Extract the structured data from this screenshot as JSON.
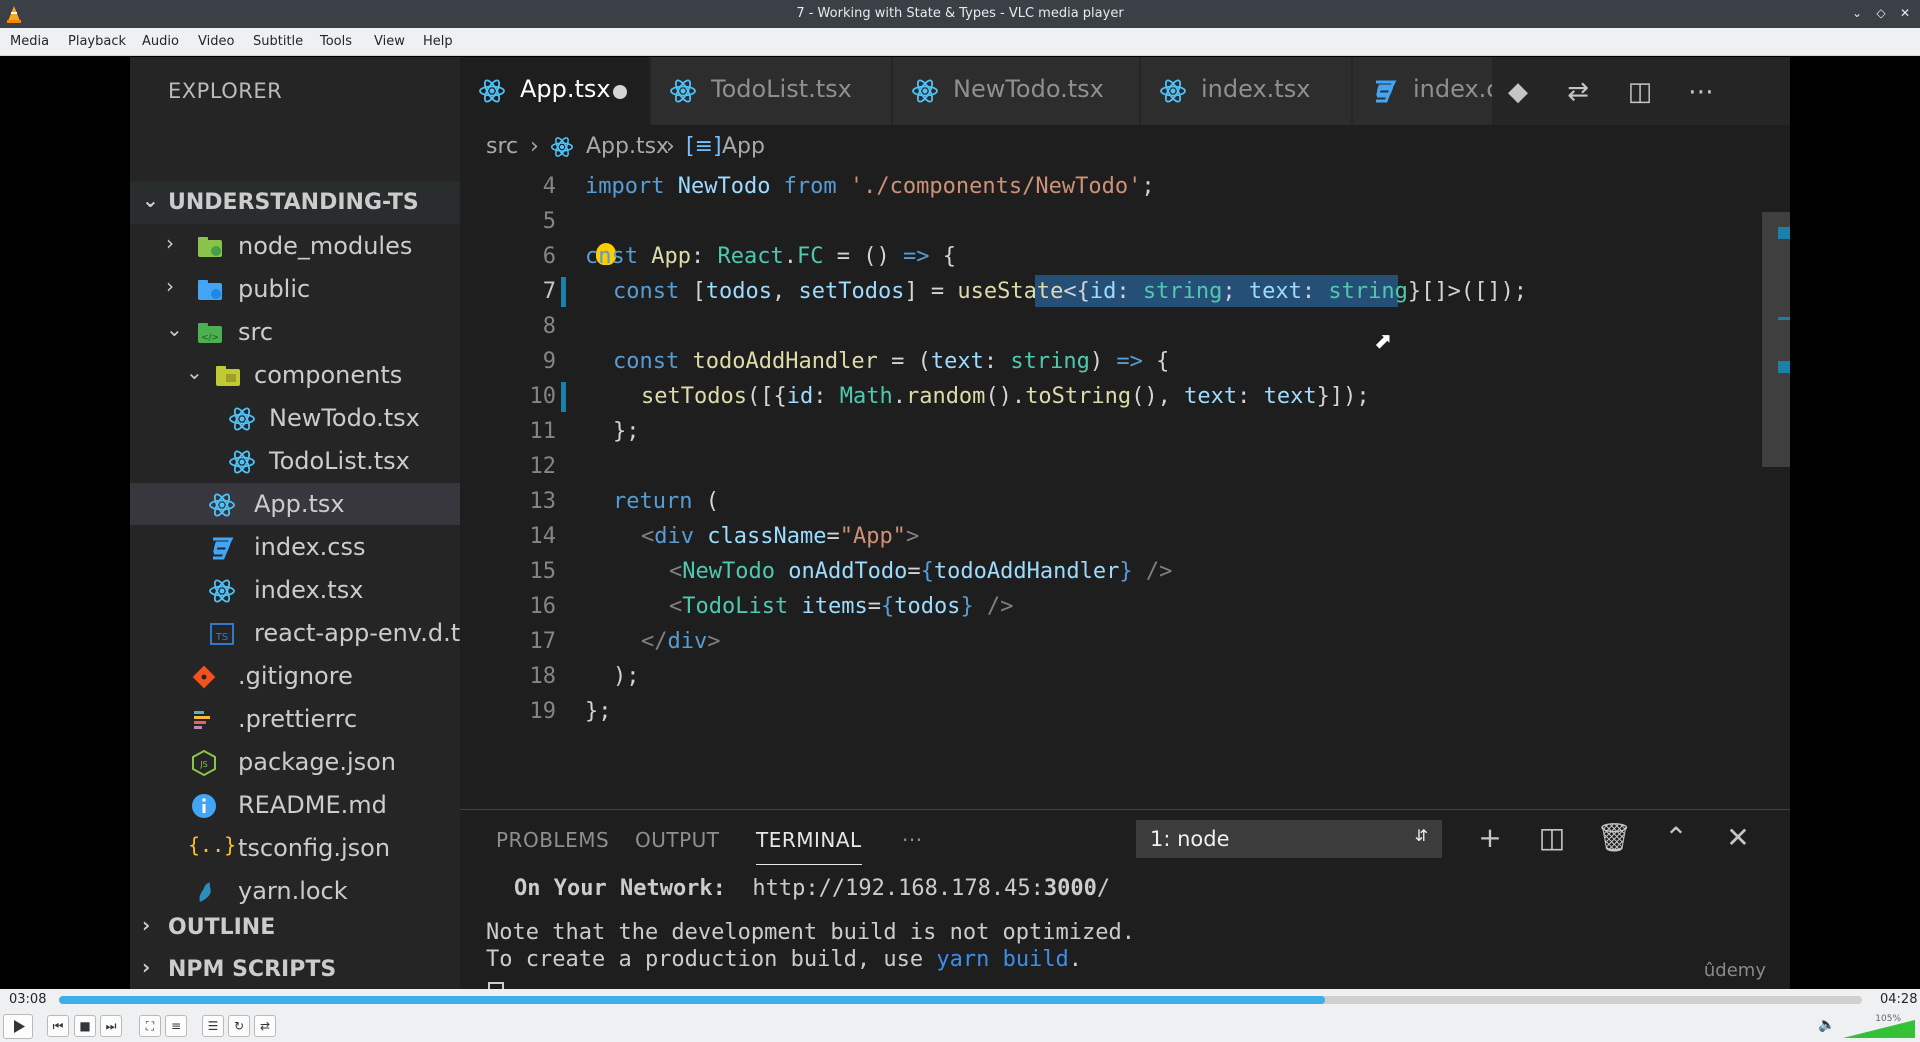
{
  "window": {
    "title": "7 - Working with State & Types - VLC media player"
  },
  "menu": [
    "Media",
    "Playback",
    "Audio",
    "Video",
    "Subtitle",
    "Tools",
    "View",
    "Help"
  ],
  "explorer": {
    "header": "EXPLORER",
    "project": "UNDERSTANDING-TS",
    "items": [
      {
        "label": "node_modules"
      },
      {
        "label": "public"
      },
      {
        "label": "src"
      },
      {
        "label": "components"
      },
      {
        "label": "NewTodo.tsx"
      },
      {
        "label": "TodoList.tsx"
      },
      {
        "label": "App.tsx"
      },
      {
        "label": "index.css"
      },
      {
        "label": "index.tsx"
      },
      {
        "label": "react-app-env.d.ts"
      },
      {
        "label": ".gitignore"
      },
      {
        "label": ".prettierrc"
      },
      {
        "label": "package.json"
      },
      {
        "label": "README.md"
      },
      {
        "label": "tsconfig.json"
      },
      {
        "label": "yarn.lock"
      }
    ],
    "outline": "OUTLINE",
    "npm_scripts": "NPM SCRIPTS"
  },
  "tabs": [
    "App.tsx",
    "TodoList.tsx",
    "NewTodo.tsx",
    "index.tsx",
    "index.cs"
  ],
  "breadcrumb": {
    "src": "src",
    "file": "App.tsx",
    "symbol": "App"
  },
  "code": {
    "line_numbers": [
      "4",
      "5",
      "6",
      "7",
      "8",
      "9",
      "10",
      "11",
      "12",
      "13",
      "14",
      "15",
      "16",
      "17",
      "18",
      "19"
    ],
    "l4": {
      "a": "import ",
      "b": "NewTodo",
      "c": " from ",
      "d": "'./components/NewTodo'",
      "e": ";"
    },
    "l6": {
      "a": "c",
      "b": "nst ",
      "c": "App",
      "d": ": ",
      "e": "React",
      "f": ".",
      "g": "FC",
      "h": " = () ",
      "i": "=>",
      "j": " {"
    },
    "l7": {
      "a": "const ",
      "b": "[",
      "c": "todos",
      "d": ", ",
      "e": "setTodos",
      "f": "] = ",
      "g": "useState",
      "h": "<",
      "i": "{",
      "j": "id",
      "k": ": ",
      "l": "string",
      "m": "; ",
      "n": "text",
      "o": ": ",
      "p": "string",
      "q": "}",
      "r": "[]>([]);"
    },
    "l9": {
      "a": "const ",
      "b": "todoAddHandler",
      "c": " = (",
      "d": "text",
      "e": ": ",
      "f": "string",
      "g": ") ",
      "h": "=>",
      "i": " {"
    },
    "l10": {
      "a": "setTodos",
      "b": "([{",
      "c": "id",
      "d": ": ",
      "e": "Math",
      "f": ".",
      "g": "random",
      "h": "().",
      "i": "toString",
      "j": "(), ",
      "k": "text",
      "l": ": ",
      "m": "text",
      "n": "}]);"
    },
    "l11": "};",
    "l13": {
      "a": "return",
      "b": " ("
    },
    "l14": {
      "a": "<",
      "b": "div",
      "c": " className",
      "d": "=",
      "e": "\"App\"",
      "f": ">"
    },
    "l15": {
      "a": "<",
      "b": "NewTodo",
      "c": " onAddTodo",
      "d": "=",
      "e": "{",
      "f": "todoAddHandler",
      "g": "}",
      "h": " />"
    },
    "l16": {
      "a": "<",
      "b": "TodoList",
      "c": " items",
      "d": "=",
      "e": "{",
      "f": "todos",
      "g": "}",
      "h": " />"
    },
    "l17": {
      "a": "</",
      "b": "div",
      "c": ">"
    },
    "l18": ");",
    "l19": "};"
  },
  "panel": {
    "tabs": [
      "PROBLEMS",
      "OUTPUT",
      "TERMINAL",
      "···"
    ],
    "terminal_select": "1: node",
    "network_label": "On Your Network:",
    "network_url_a": "http://192.168.178.45:",
    "network_url_port": "3000",
    "network_url_b": "/",
    "note1": "Note that the development build is not optimized.",
    "note2a": "To create a production build, use ",
    "note2b": "yarn build",
    "note2c": ".",
    "watermark": "ûdemy"
  },
  "player": {
    "elapsed": "03:08",
    "total": "04:28",
    "progress": 0.702,
    "volume_label": "105%"
  },
  "colors": {
    "vscode_bg": "#1e1e1e",
    "sidebar_bg": "#252526",
    "accent": "#3daee9",
    "selection": "#264f78"
  }
}
